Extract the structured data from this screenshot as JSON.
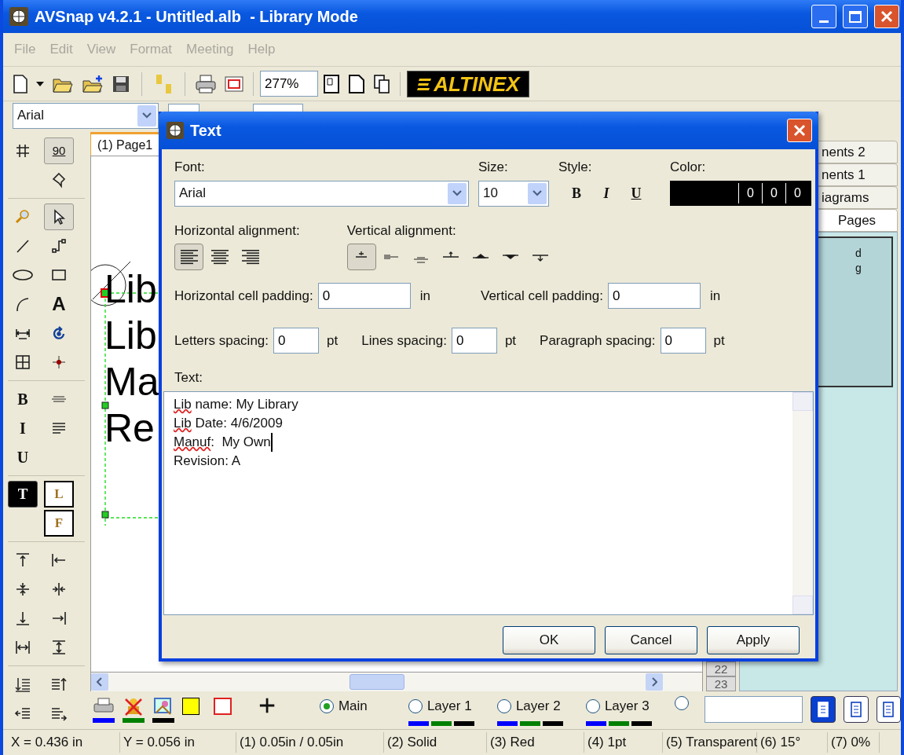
{
  "window": {
    "title": "AVSnap v4.2.1 - Untitled.alb  - Library Mode"
  },
  "menu": [
    {
      "label": "File",
      "disabled": true
    },
    {
      "label": "Edit",
      "disabled": true
    },
    {
      "label": "View",
      "disabled": true
    },
    {
      "label": "Format",
      "disabled": true
    },
    {
      "label": "Meeting",
      "disabled": true
    },
    {
      "label": "Help",
      "disabled": true
    }
  ],
  "toolbar": {
    "zoom": "277%",
    "logo": "ALTINEX"
  },
  "format_bar": {
    "font": "Arial"
  },
  "left_toolbar": [
    [
      {
        "left": {
          "kind": "grid",
          "selected": false
        },
        "right": {
          "kind": "label",
          "label": "90",
          "selected": true
        }
      },
      {
        "right": {
          "kind": "shape",
          "selected": false
        }
      }
    ],
    [
      {
        "left": {
          "kind": "zoom",
          "selected": false
        },
        "right": {
          "kind": "pointer",
          "selected": true
        }
      },
      {
        "left": {
          "kind": "line",
          "selected": false
        },
        "right": {
          "kind": "connector",
          "selected": false
        }
      },
      {
        "left": {
          "kind": "ellipse",
          "selected": false
        },
        "right": {
          "kind": "rect",
          "selected": false
        }
      },
      {
        "left": {
          "kind": "arc",
          "selected": false
        },
        "right": {
          "kind": "label",
          "label": "A",
          "selected": false
        }
      },
      {
        "left": {
          "kind": "dimension",
          "selected": false
        },
        "right": {
          "kind": "rotate",
          "selected": false
        }
      },
      {
        "left": {
          "kind": "table",
          "selected": false
        },
        "right": {
          "kind": "point",
          "selected": false
        }
      }
    ],
    [
      {
        "left": {
          "kind": "serif",
          "label": "B",
          "selected": false
        },
        "right": {
          "kind": "centerline",
          "selected": false
        }
      },
      {
        "left": {
          "kind": "serif",
          "label": "I",
          "selected": false
        },
        "right": {
          "kind": "lines",
          "selected": false
        }
      },
      {
        "left": {
          "kind": "serif",
          "label": "U",
          "selected": false
        }
      }
    ],
    [
      {
        "left": {
          "kind": "dark",
          "label": "T",
          "selected": true
        },
        "right": {
          "kind": "boxed",
          "label": "L",
          "selected": false
        }
      },
      {
        "right": {
          "kind": "boxed",
          "label": "F",
          "selected": false
        }
      }
    ],
    [
      {
        "left": {
          "kind": "align_top",
          "selected": false
        },
        "right": {
          "kind": "align_left",
          "selected": false
        }
      },
      {
        "left": {
          "kind": "center_h",
          "selected": false
        },
        "right": {
          "kind": "center_v",
          "selected": false
        }
      },
      {
        "left": {
          "kind": "align_bottom",
          "selected": false
        },
        "right": {
          "kind": "align_right",
          "selected": false
        }
      },
      {
        "left": {
          "kind": "space_h",
          "selected": false
        },
        "right": {
          "kind": "space_v",
          "selected": false
        }
      }
    ],
    [
      {
        "left": {
          "kind": "order_down",
          "selected": false
        },
        "right": {
          "kind": "order_up",
          "selected": false
        }
      },
      {
        "left": {
          "kind": "order_back",
          "selected": false
        },
        "right": {
          "kind": "order_front",
          "selected": false
        }
      }
    ]
  ],
  "canvas": {
    "tab": {
      "label": "(1) Page1",
      "selected": true
    },
    "text_lines": [
      "Lib",
      "Lib",
      "Ma",
      "Re"
    ],
    "page_numbers": [
      "22",
      "23"
    ]
  },
  "right_panel": {
    "tabs": [
      {
        "label": "nents 2",
        "selected": false
      },
      {
        "label": "nents 1",
        "selected": false
      },
      {
        "label": "iagrams",
        "selected": false
      },
      {
        "label": "Pages",
        "selected": true
      }
    ],
    "lines": [
      "d",
      "g"
    ]
  },
  "layers": [
    {
      "label": "Main",
      "selected": true
    },
    {
      "label": "Layer 1",
      "selected": false
    },
    {
      "label": "Layer 2",
      "selected": false
    },
    {
      "label": "Layer 3",
      "selected": false
    },
    {
      "selected": false
    }
  ],
  "status_bar": [
    "X = 0.436 in",
    "Y = 0.056 in",
    "(1) 0.05in / 0.05in",
    "(2) Solid",
    "(3) Red",
    "(4) 1pt",
    "(5) Transparent",
    "(6) 15°",
    "(7) 0%"
  ],
  "dialog": {
    "title": "Text",
    "font_label": "Font:",
    "font": "Arial",
    "size_label": "Size:",
    "size": "10",
    "style_label": "Style:",
    "styles": [
      {
        "label": "B",
        "kind": "bold",
        "selected": false
      },
      {
        "label": "I",
        "kind": "italic",
        "selected": false
      },
      {
        "label": "U",
        "kind": "underline",
        "selected": false
      }
    ],
    "color_label": "Color:",
    "color": "#000000",
    "rgb": [
      "0",
      "0",
      "0"
    ],
    "h_align_label": "Horizontal alignment:",
    "h_align": [
      {
        "kind": "left",
        "selected": true
      },
      {
        "kind": "center",
        "selected": false
      },
      {
        "kind": "right",
        "selected": false
      }
    ],
    "v_align_label": "Vertical alignment:",
    "v_align": [
      {
        "kind": "middle",
        "selected": true
      },
      {
        "kind": "center",
        "selected": false
      },
      {
        "kind": "low",
        "selected": false
      },
      {
        "kind": "top_up",
        "selected": false
      },
      {
        "kind": "top_tri",
        "selected": false
      },
      {
        "kind": "bottom_tri",
        "selected": false
      },
      {
        "kind": "bottom_down",
        "selected": false
      }
    ],
    "paddings": [
      {
        "label": "Horizontal cell padding:",
        "value": "0",
        "unit": "in"
      },
      {
        "label": "Vertical cell padding:",
        "value": "0",
        "unit": "in"
      }
    ],
    "spacings": [
      {
        "label": "Letters spacing:",
        "value": "0",
        "unit": "pt"
      },
      {
        "label": "Lines spacing:",
        "value": "0",
        "unit": "pt"
      },
      {
        "label": "Paragraph spacing:",
        "value": "0",
        "unit": "pt"
      }
    ],
    "text_label": "Text:",
    "text": [
      {
        "caret": false,
        "parts": [
          {
            "text": "Lib",
            "misspelled": true
          },
          {
            "text": " name: My Library",
            "misspelled": false
          }
        ]
      },
      {
        "caret": false,
        "parts": [
          {
            "text": "Lib",
            "misspelled": true
          },
          {
            "text": " Date: 4/6/2009",
            "misspelled": false
          }
        ]
      },
      {
        "caret": true,
        "parts": [
          {
            "text": "Manuf",
            "misspelled": true
          },
          {
            "text": ":  My Own",
            "misspelled": false
          }
        ]
      },
      {
        "caret": false,
        "parts": [
          {
            "text": "Revision: A",
            "misspelled": false
          }
        ]
      }
    ],
    "buttons": [
      "OK",
      "Cancel",
      "Apply"
    ]
  }
}
